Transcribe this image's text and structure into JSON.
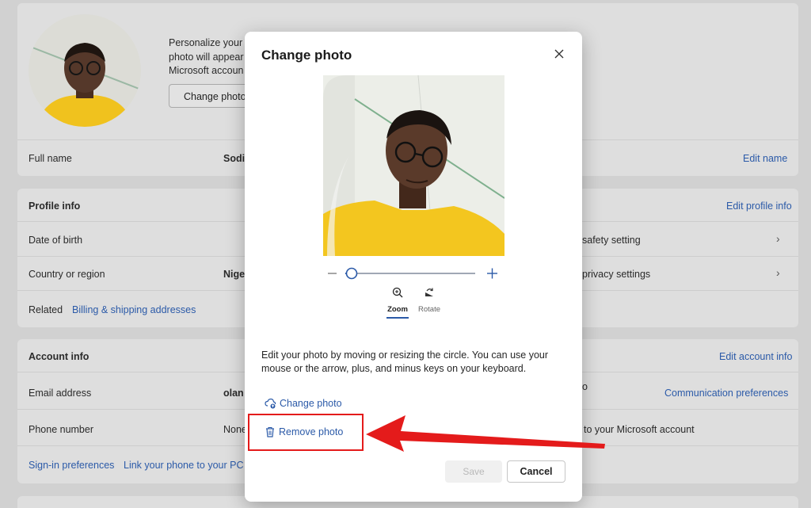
{
  "background": {
    "intro_lines": [
      "Personalize your a",
      "photo will appear",
      "Microsoft accoun"
    ],
    "change_photo_button": "Change photo",
    "full_name_label": "Full name",
    "full_name_value": "Sodi",
    "edit_name": "Edit name",
    "profile_info": {
      "heading": "Profile info",
      "edit_link": "Edit profile info",
      "dob_label": "Date of birth",
      "country_label": "Country or region",
      "country_value": "Nige",
      "related_label": "Related",
      "related_link": "Billing & shipping addresses",
      "safety_setting": "safety setting",
      "privacy_settings": "privacy settings"
    },
    "account_info": {
      "heading": "Account info",
      "edit_link": "Edit account info",
      "email_label": "Email address",
      "email_value": "olan",
      "phone_label": "Phone number",
      "phone_value": "None",
      "partial_text": "o",
      "communication_link": "Communication preferences",
      "microsoft_account_text": "to your Microsoft account",
      "signin_link": "Sign-in preferences",
      "link_phone": "Link your phone to your PC"
    }
  },
  "dialog": {
    "title": "Change photo",
    "zoom_label": "Zoom",
    "rotate_label": "Rotate",
    "description": "Edit your photo by moving or resizing the circle. You can use your mouse or the arrow, plus, and minus keys on your keyboard.",
    "change_photo": "Change photo",
    "remove_photo": "Remove photo",
    "save": "Save",
    "cancel": "Cancel",
    "zoom_level": 0.1
  },
  "colors": {
    "accent": "#2b5aa8",
    "annotation_red": "#e41b1b"
  }
}
